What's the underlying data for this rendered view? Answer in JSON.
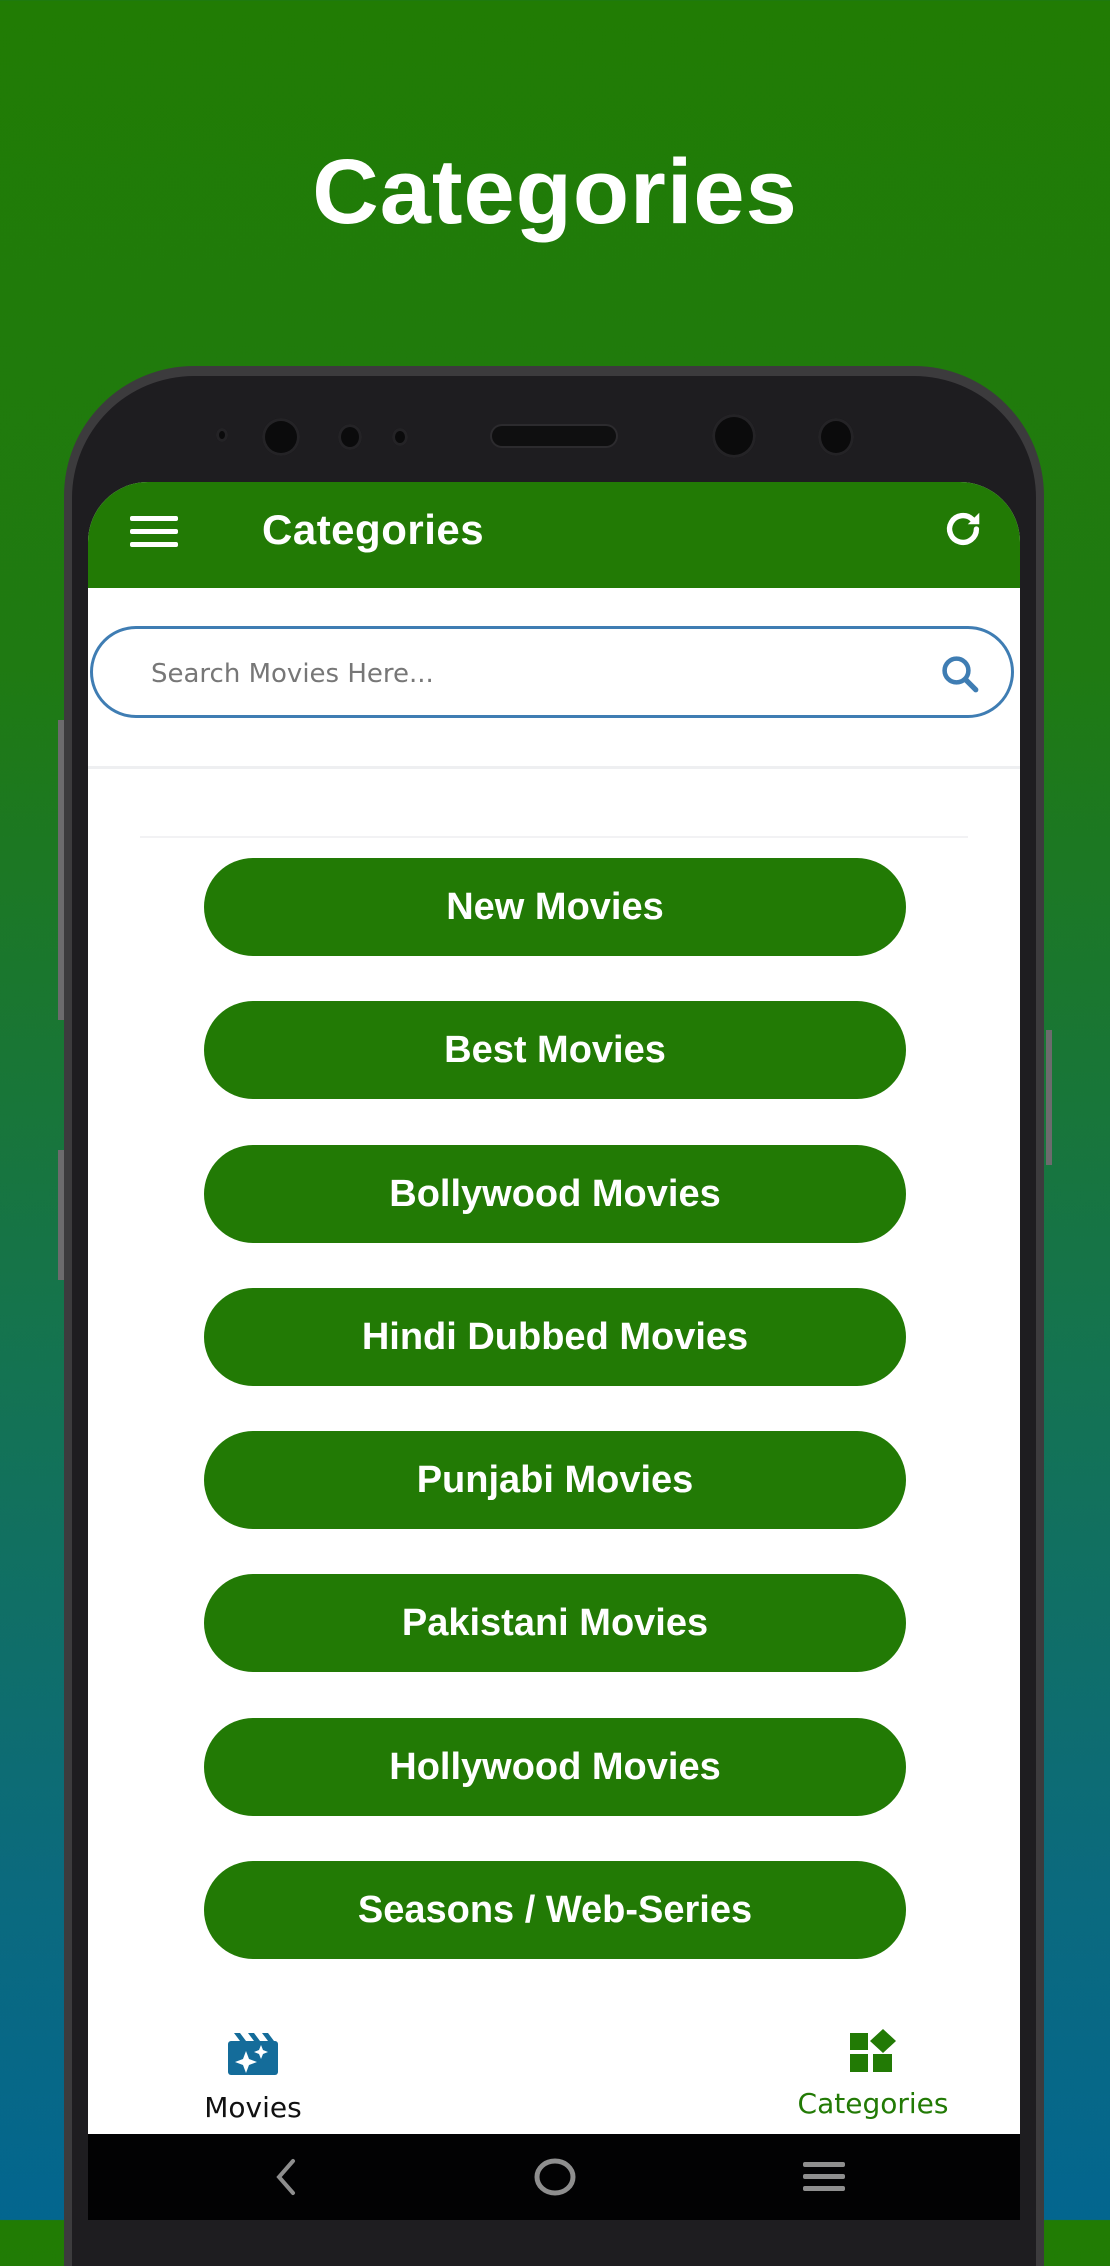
{
  "promo": {
    "title": "Categories"
  },
  "appbar": {
    "title": "Categories",
    "menu_icon": "hamburger-menu-icon",
    "refresh_icon": "refresh-icon"
  },
  "search": {
    "placeholder": "Search Movies Here...",
    "value": "",
    "icon": "search-icon"
  },
  "categories": [
    {
      "label": "New Movies"
    },
    {
      "label": "Best Movies"
    },
    {
      "label": "Bollywood Movies"
    },
    {
      "label": "Hindi Dubbed Movies"
    },
    {
      "label": "Punjabi Movies"
    },
    {
      "label": "Pakistani Movies"
    },
    {
      "label": "Hollywood Movies"
    },
    {
      "label": "Seasons / Web-Series"
    }
  ],
  "bottom_nav": {
    "items": [
      {
        "label": "Movies",
        "icon": "movie-clapperboard-icon",
        "active": false
      },
      {
        "label": "Categories",
        "icon": "categories-grid-icon",
        "active": true
      }
    ]
  },
  "system_nav": {
    "back_icon": "back-chevron-icon",
    "home_icon": "home-circle-icon",
    "recents_icon": "recents-lines-icon"
  },
  "colors": {
    "primary_green": "#227a05",
    "search_border": "#3f7db3",
    "movies_icon_blue": "#146c9a",
    "active_nav": "#227a05",
    "inactive_nav": "#111111"
  }
}
